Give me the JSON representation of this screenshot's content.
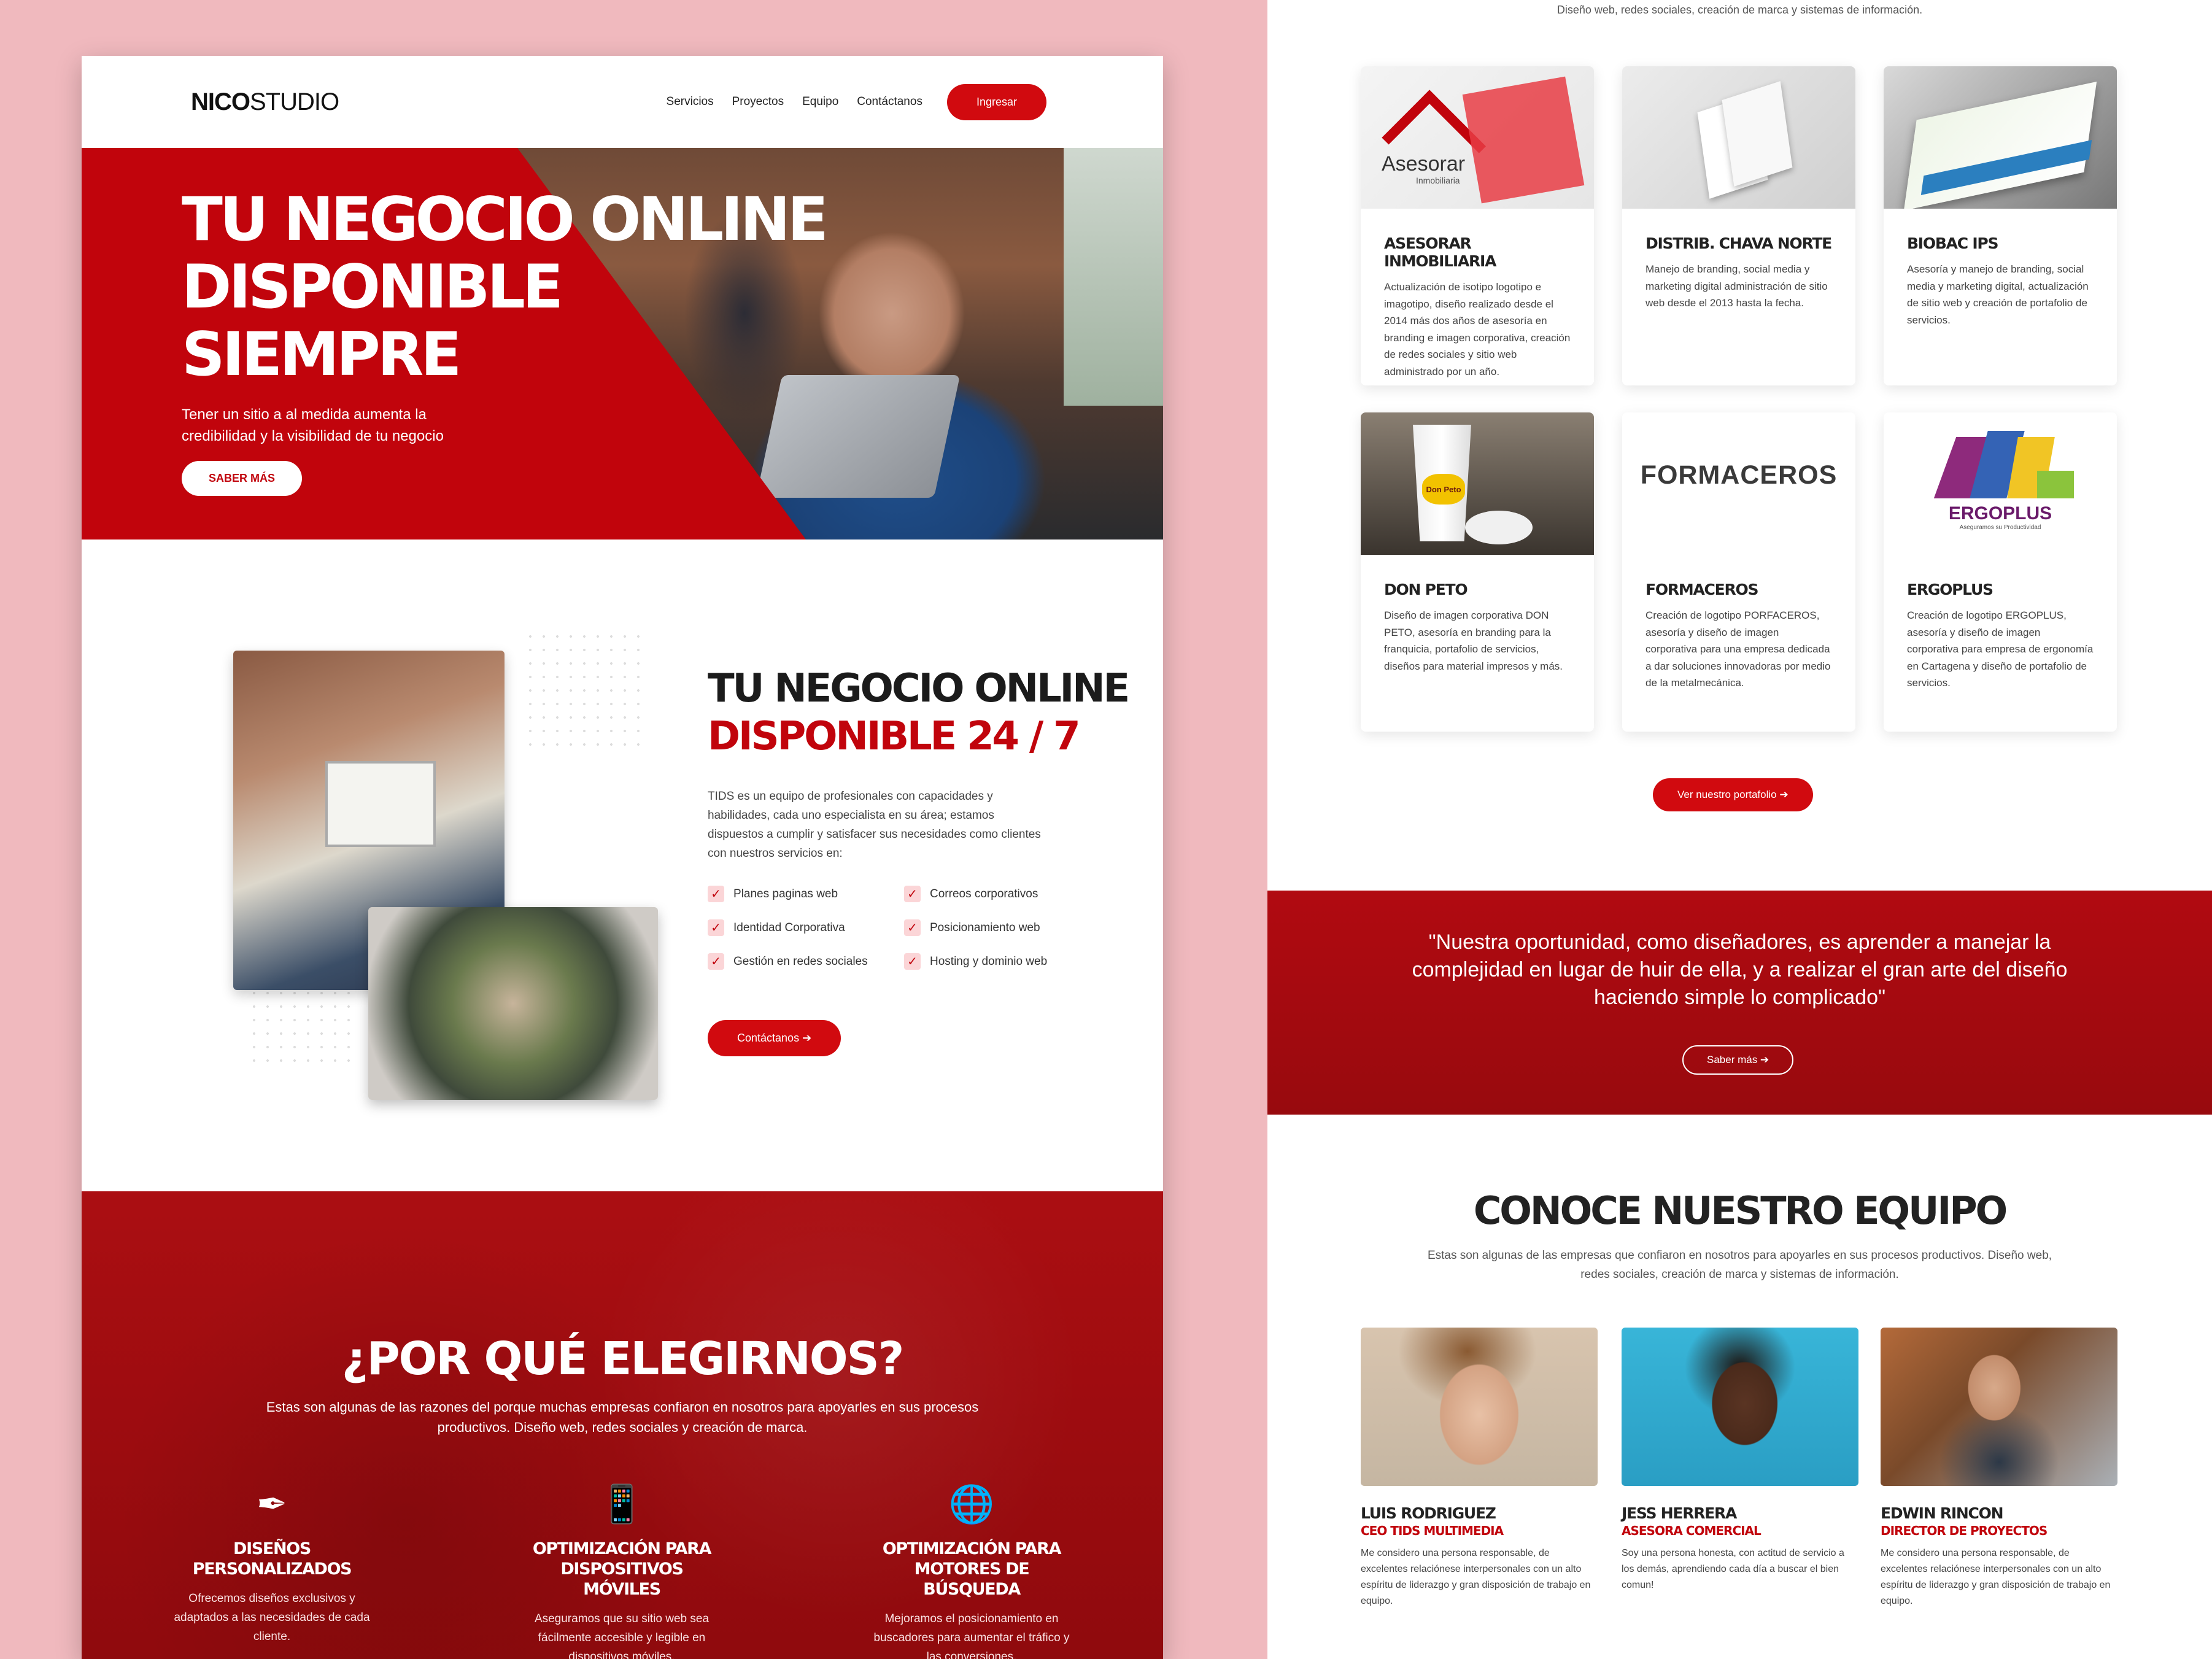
{
  "left": {
    "logo_bold": "NICO",
    "logo_rest": "STUDIO",
    "nav": [
      "Servicios",
      "Proyectos",
      "Equipo",
      "Contáctanos"
    ],
    "login_label": "Ingresar",
    "hero": {
      "title": [
        "TU NEGOCIO ONLINE",
        "DISPONIBLE",
        "SIEMPRE"
      ],
      "text": "Tener un sitio a al medida aumenta la credibilidad y la visibilidad de tu negocio",
      "cta": "SABER MÁS"
    },
    "about": {
      "title_line1": "TU NEGOCIO ONLINE",
      "title_line2": "DISPONIBLE 24 / 7",
      "text": "TIDS es un equipo de profesionales con capacidades y habilidades, cada uno especialista en su área; estamos dispuestos a cumplir y satisfacer sus necesidades como clientes con nuestros servicios en:",
      "services": [
        "Planes paginas web",
        "Correos corporativos",
        "Identidad Corporativa",
        "Posicionamiento web",
        "Gestión en redes sociales",
        "Hosting y dominio web"
      ],
      "cta": "Contáctanos ➔"
    },
    "why": {
      "title": "¿POR QUÉ ELEGIRNOS?",
      "text": "Estas son algunas de las razones del porque muchas empresas confiaron en nosotros para apoyarles en sus procesos productivos. Diseño web, redes sociales y creación de marca.",
      "features": [
        {
          "icon": "✒",
          "title": "DISEÑOS PERSONALIZADOS",
          "text": "Ofrecemos diseños exclusivos y adaptados a las necesidades de cada cliente."
        },
        {
          "icon": "📱",
          "title": "OPTIMIZACIÓN PARA DISPOSITIVOS MÓVILES",
          "text": "Aseguramos que su sitio web sea fácilmente accesible y legible en dispositivos móviles."
        },
        {
          "icon": "🌐",
          "title": "OPTIMIZACIÓN PARA MOTORES DE BÚSQUEDA",
          "text": "Mejoramos el posicionamiento en buscadores para aumentar el tráfico y las conversiones."
        }
      ]
    }
  },
  "right": {
    "top_text": "Diseño web, redes sociales, creación de marca y sistemas de información.",
    "projects": [
      {
        "title": "ASESORAR INMOBILIARIA",
        "text": "Actualización de isotipo logotipo e imagotipo, diseño realizado desde el 2014 más dos años de asesoría en branding e imagen corporativa, creación de redes sociales y sitio web administrado por un año.",
        "brand": "Asesorar",
        "sub": "Inmobiliaria"
      },
      {
        "title": "DISTRIB. CHAVA NORTE",
        "text": "Manejo de branding, social media y marketing digital administración de sitio web desde el 2013 hasta la fecha.",
        "brand": "",
        "sub": ""
      },
      {
        "title": "BIOBAC IPS",
        "text": "Asesoría y manejo de branding, social media y marketing digital, actualización de sitio web y creación de portafolio de servicios.",
        "brand": "",
        "sub": ""
      },
      {
        "title": "DON PETO",
        "text": "Diseño de imagen corporativa DON PETO, asesoría en branding para la franquicia, portafolio de servicios, diseños para material impresos y más.",
        "brand": "Don Peto",
        "sub": ""
      },
      {
        "title": "FORMACEROS",
        "text": "Creación de logotipo PORFACEROS, asesoría y diseño de imagen corporativa para una empresa dedicada a dar soluciones innovadoras por medio de la metalmecánica.",
        "brand": "FORMACEROS",
        "sub": ""
      },
      {
        "title": "ERGOPLUS",
        "text": "Creación de logotipo ERGOPLUS, asesoría y diseño de imagen corporativa para empresa de ergonomía en Cartagena y diseño de portafolio de servicios.",
        "brand": "ERGOPLUS",
        "sub": "Aseguramos su Productividad"
      }
    ],
    "portfolio_cta": "Ver nuestro portafolio ➔",
    "quote": "\"Nuestra oportunidad, como diseñadores, es aprender a manejar la complejidad en lugar de huir de ella, y a realizar el gran arte del diseño haciendo simple lo complicado\"",
    "quote_cta": "Saber más ➔",
    "team": {
      "title": "CONOCE NUESTRO EQUIPO",
      "text": "Estas son algunas de las empresas que confiaron en nosotros para apoyarles en sus procesos productivos. Diseño web, redes sociales, creación de marca y sistemas de información.",
      "members": [
        {
          "name": "LUIS RODRIGUEZ",
          "role": "CEO TIDS MULTIMEDIA",
          "text": "Me considero una persona responsable, de excelentes relaciónese interpersonales con un alto espíritu de liderazgo y gran disposición de trabajo en equipo."
        },
        {
          "name": "JESS HERRERA",
          "role": "ASESORA COMERCIAL",
          "text": "Soy una persona honesta, con actitud de servicio a los demás, aprendiendo cada día a buscar el bien comun!"
        },
        {
          "name": "EDWIN RINCON",
          "role": "DIRECTOR DE PROYECTOS",
          "text": "Me considero una persona responsable, de excelentes relaciónese interpersonales con un alto espíritu de liderazgo y gran disposición de trabajo en equipo."
        }
      ]
    }
  },
  "colors": {
    "brand_red": "#c1040c",
    "background": "#f0b9be"
  }
}
